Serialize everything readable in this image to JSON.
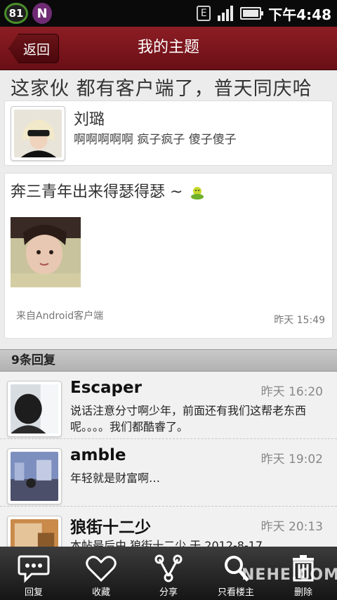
{
  "status_bar": {
    "battery_level": "81",
    "app_badge": "N",
    "network": "E",
    "time": "下午4:48"
  },
  "header": {
    "back_label": "返回",
    "title": "我的主题"
  },
  "topic": {
    "title": "这家伙 都有客户端了，普天同庆哈"
  },
  "author": {
    "name": "刘璐",
    "signature": "啊啊啊啊啊 疯子疯子 傻子傻子"
  },
  "post": {
    "text": "奔三青年出来得瑟得瑟 ~",
    "source": "来自Android客户端",
    "time": "昨天 15:49"
  },
  "replies": {
    "header": "9条回复",
    "items": [
      {
        "name": "Escaper",
        "time": "昨天 16:20",
        "text": "说话注意分寸啊少年，前面还有我们这帮老东西呢。。。。我们都酷睿了。"
      },
      {
        "name": "amble",
        "time": "昨天 19:02",
        "text": "年轻就是财富啊…"
      },
      {
        "name": "狼街十二少",
        "time": "昨天 20:13",
        "text": "本帖最后由 狼街十二少 于 2012-8-17"
      }
    ]
  },
  "toolbar": {
    "reply": "回复",
    "favorite": "收藏",
    "share": "分享",
    "owner_only": "只看楼主",
    "delete": "删除"
  },
  "watermark": "NEHE.COM",
  "colors": {
    "title_bar": "#7d1820",
    "status_bar": "#0a0a0a",
    "toolbar": "#222222"
  }
}
